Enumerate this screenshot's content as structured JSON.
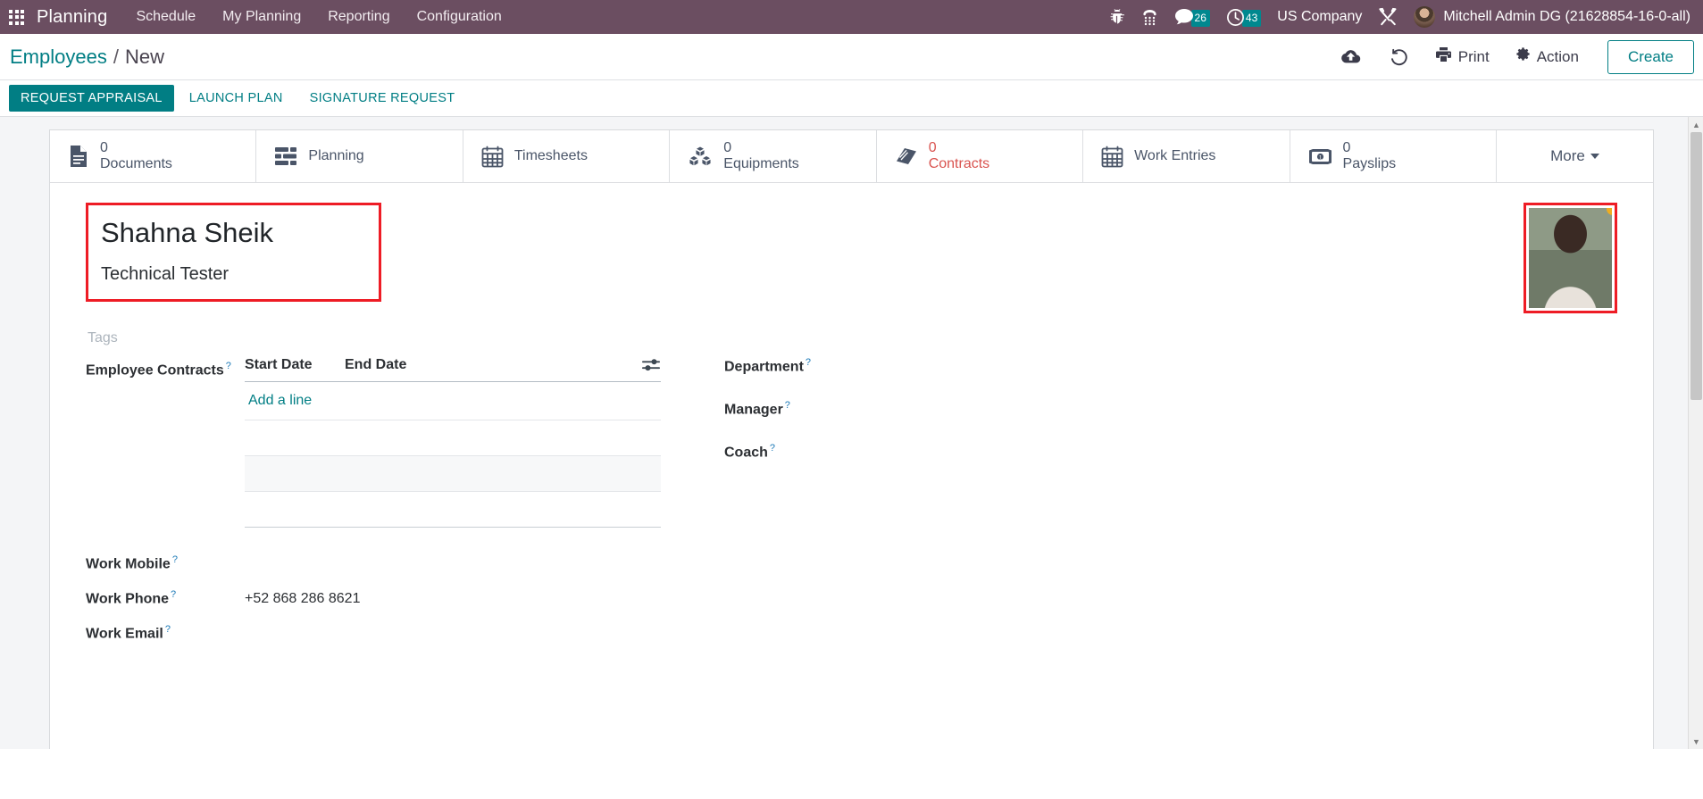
{
  "navbar": {
    "apps_icon": "apps-grid-icon",
    "brand": "Planning",
    "menu": [
      {
        "label": "Schedule"
      },
      {
        "label": "My Planning"
      },
      {
        "label": "Reporting"
      },
      {
        "label": "Configuration"
      }
    ],
    "bug_icon": "bug-icon",
    "dialpad_icon": "phone-dialpad-icon",
    "messages": {
      "icon": "chat-bubble-icon",
      "count": "26"
    },
    "activities": {
      "icon": "clock-activity-icon",
      "count": "43"
    },
    "company": "US Company",
    "tools_icon": "tools-icon",
    "user": "Mitchell Admin DG (21628854-16-0-all)"
  },
  "control_panel": {
    "breadcrumb": {
      "root": "Employees",
      "separator": "/",
      "current": "New"
    },
    "save_icon": "cloud-upload-icon",
    "discard_icon": "undo-icon",
    "print_label": "Print",
    "print_icon": "printer-icon",
    "action_label": "Action",
    "action_icon": "gear-icon",
    "create_label": "Create"
  },
  "action_buttons": [
    {
      "label": "REQUEST APPRAISAL",
      "primary": true
    },
    {
      "label": "LAUNCH PLAN",
      "primary": false
    },
    {
      "label": "SIGNATURE REQUEST",
      "primary": false
    }
  ],
  "smart_buttons": [
    {
      "value": "0",
      "label": "Documents",
      "icon": "document-icon",
      "danger": false
    },
    {
      "value": "",
      "label": "Planning",
      "icon": "gantt-bars-icon",
      "danger": false
    },
    {
      "value": "",
      "label": "Timesheets",
      "icon": "calendar-icon",
      "danger": false
    },
    {
      "value": "0",
      "label": "Equipments",
      "icon": "cubes-icon",
      "danger": false
    },
    {
      "value": "0",
      "label": "Contracts",
      "icon": "book-icon",
      "danger": true
    },
    {
      "value": "",
      "label": "Work Entries",
      "icon": "calendar-icon",
      "danger": false
    },
    {
      "value": "0",
      "label": "Payslips",
      "icon": "money-bill-icon",
      "danger": false
    }
  ],
  "more_button": {
    "label": "More",
    "icon": "chevron-down-icon"
  },
  "employee": {
    "name": "Shahna Sheik",
    "job_title": "Technical Tester",
    "tags_placeholder": "Tags",
    "photo": {
      "name": "employee-photo",
      "status_dot_color": "#f0ad20"
    }
  },
  "contracts": {
    "label": "Employee Contracts",
    "help": "?",
    "columns": {
      "start_date": "Start Date",
      "end_date": "End Date"
    },
    "optional_columns_icon": "sliders-icon",
    "add_line": "Add a line",
    "rows": []
  },
  "left_fields": [
    {
      "label": "Work Mobile",
      "help": "?",
      "value": ""
    },
    {
      "label": "Work Phone",
      "help": "?",
      "value": "+52 868 286 8621"
    },
    {
      "label": "Work Email",
      "help": "?",
      "value": ""
    }
  ],
  "right_fields": [
    {
      "label": "Department",
      "help": "?",
      "value": ""
    },
    {
      "label": "Manager",
      "help": "?",
      "value": ""
    },
    {
      "label": "Coach",
      "help": "?",
      "value": ""
    }
  ],
  "colors": {
    "navbar_bg": "#6b4e61",
    "accent_teal": "#017e84",
    "badge_teal": "#00888f",
    "danger_red": "#d9534f",
    "highlight_red": "#ee1c25"
  },
  "scrollbar": {
    "up": "▲",
    "down": "▼"
  }
}
